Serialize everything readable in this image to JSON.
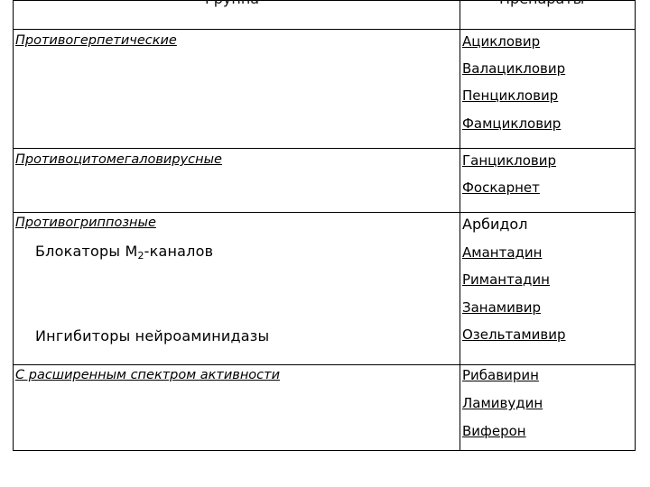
{
  "table": {
    "headers": {
      "group": "Группа",
      "drugs": "Препараты"
    },
    "categories": [
      {
        "label": "Противогерпетические"
      },
      {
        "label": "Противоцитомегаловирусные"
      },
      {
        "label": "Противогриппозные"
      },
      {
        "label": "С расширенным спектром активности"
      }
    ],
    "subgroups": [
      {
        "label_prefix": "Блокаторы М",
        "label_sub": "2",
        "label_suffix": "-каналов"
      },
      {
        "label": "Ингибиторы нейроаминидазы"
      }
    ],
    "drugs": [
      "Ацикловир",
      "Валацикловир",
      "Пенцикловир",
      "Фамцикловир",
      "Ганцикловир",
      "Фоскарнет",
      "Арбидол",
      "Амантадин",
      "Римантадин",
      "Занамивир",
      "Озельтамивир",
      "Рибавирин",
      "Ламивудин",
      "Виферон"
    ]
  }
}
